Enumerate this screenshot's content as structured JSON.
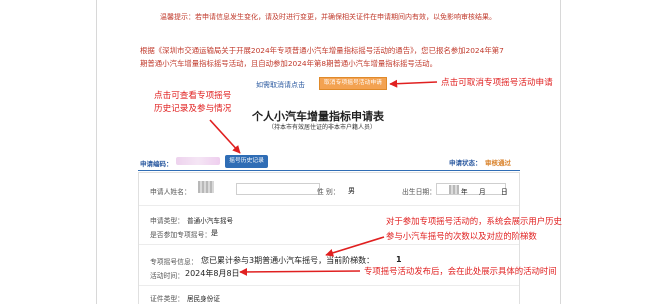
{
  "notice": {
    "text": "温馨提示：若申请信息发生变化，请及时进行变更，并确保相关证件在申请期间内有效，以免影响审核结果。"
  },
  "intro_paragraph": {
    "lines": [
      "根据《深圳市交通运输局关于开展2024年专项普通小汽车增量指标摇号活动的通告》，您已报名参加2024年第7",
      "期普通小汽车增量指标摇号活动，且自动参加2024年第8期普通小汽车增量指标摇号活动。"
    ]
  },
  "cancel": {
    "prompt": "如需取消请点击",
    "button_label": "取消专项摇号活动申请"
  },
  "annotations": {
    "cancel": "点击可取消专项摇号活动申请",
    "history_line1": "点击可查看专项摇号",
    "history_line2": "历史记录及参与情况",
    "count_line1": "对于参加专项摇号活动的，系统会展示用户历史",
    "count_line2": "参与小汽车摇号的次数以及对应的阶梯数",
    "time": "专项摇号活动发布后，会在此处展示具体的活动时间"
  },
  "form": {
    "title": "个人小汽车增量指标申请表",
    "subtitle": "（持本市有效居住证的非本市户籍人员）",
    "app_code_label": "申请编码：",
    "history_button": "摇号历史记录",
    "app_status_label": "申请状态：",
    "app_status_value": "审核通过",
    "status_color": "#d9822b",
    "fields": {
      "name_label": "申请人姓名：",
      "gender_label": "性    别：",
      "gender_value": "男",
      "dob_label": "出生日期：",
      "apply_type_label": "申请类型：",
      "apply_type_value": "普通小汽车摇号",
      "special_label": "是否参加专项摇号：",
      "special_value": "是",
      "lottery_info_label": "专项摇号信息：",
      "lottery_info_text": "您已累计参与3期普通小汽车摇号，当前阶梯数：",
      "lottery_step": "1",
      "activity_time_label": "活动时间：",
      "activity_time_value": "2024年8月8日",
      "id_type_label": "证件类型：",
      "id_type_value": "居民身份证"
    }
  },
  "colors": {
    "annotation_red": "#e02020",
    "link_blue": "#2c5aa0",
    "button_orange": "#f3a251",
    "button_blue": "#2f6db5"
  }
}
